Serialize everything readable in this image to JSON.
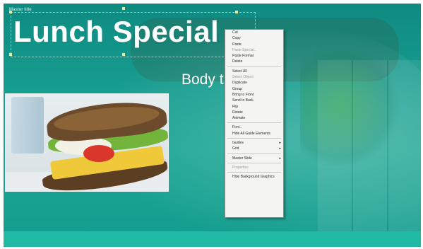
{
  "slide": {
    "master_tag": "Master title",
    "title": "Lunch Special",
    "body_placeholder": "Body t"
  },
  "context_menu": {
    "items": [
      {
        "label": "Cut",
        "dim": false
      },
      {
        "label": "Copy",
        "dim": false
      },
      {
        "label": "Paste",
        "dim": false
      },
      {
        "label": "Paste Special...",
        "dim": true
      },
      {
        "label": "Paste Format",
        "dim": false
      },
      {
        "label": "Delete",
        "dim": false
      },
      {
        "sep": true
      },
      {
        "label": "Select All",
        "dim": false
      },
      {
        "label": "Select Object",
        "dim": true
      },
      {
        "label": "Duplicate",
        "dim": false
      },
      {
        "label": "Group",
        "dim": false
      },
      {
        "label": "Bring to Front",
        "dim": false
      },
      {
        "label": "Send to Back",
        "dim": false
      },
      {
        "label": "Flip",
        "dim": false
      },
      {
        "label": "Rotate",
        "dim": false
      },
      {
        "label": "Animate",
        "dim": false
      },
      {
        "sep": true
      },
      {
        "label": "Font...",
        "dim": false
      },
      {
        "label": "Hide All Guide Elements",
        "dim": false
      },
      {
        "sep": true
      },
      {
        "label": "Guides",
        "dim": false,
        "submenu": true
      },
      {
        "label": "Grid",
        "dim": false,
        "submenu": true
      },
      {
        "sep": true
      },
      {
        "label": "Master Slide",
        "dim": false,
        "submenu": true
      },
      {
        "sep": true
      },
      {
        "label": "Properties",
        "dim": true
      },
      {
        "sep": true
      },
      {
        "label": "Hide Background Graphics",
        "dim": false
      }
    ]
  },
  "colors": {
    "slide_bg": "#139d8e",
    "bottom_band": "#1fb9a4",
    "title_text": "#ffffff",
    "menu_bg": "#f4f4f2"
  }
}
